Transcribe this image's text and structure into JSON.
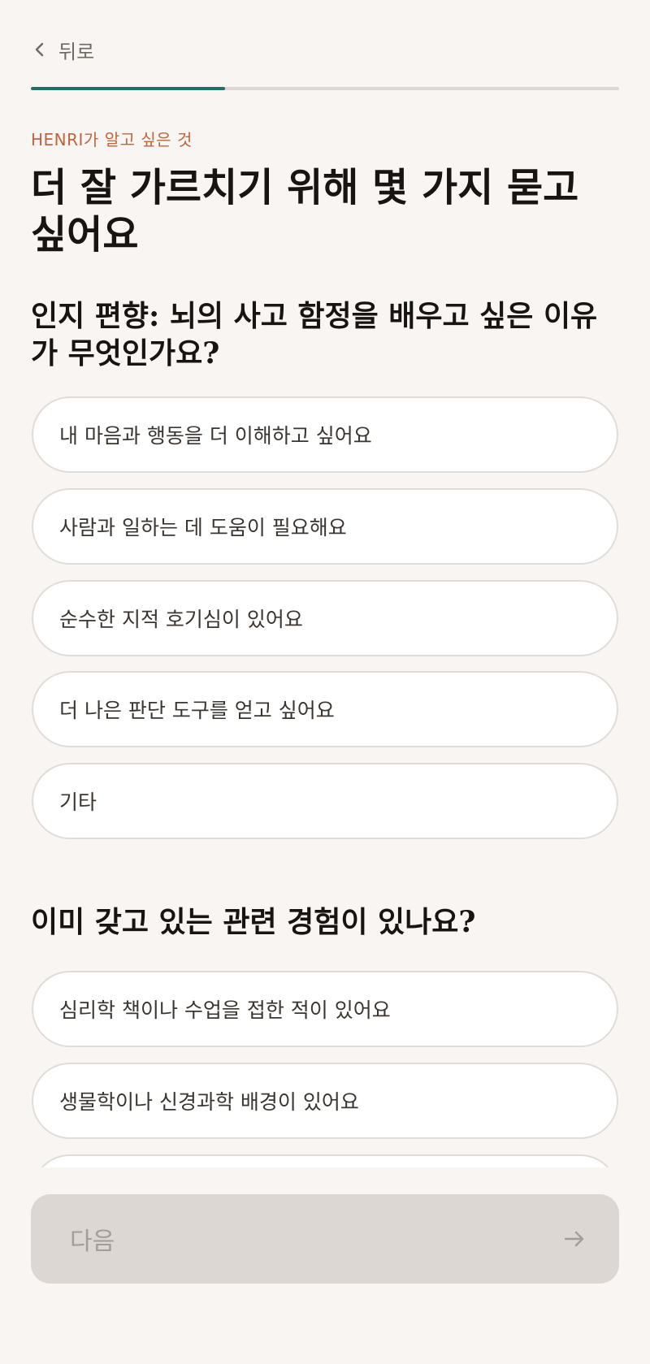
{
  "header": {
    "back_label": "뒤로",
    "back_icon": "chevron-left-icon"
  },
  "progress": {
    "fraction": 0.33,
    "fill_color": "#1f6f66",
    "track_color": "#dcd7d2"
  },
  "intro": {
    "eyebrow": "HENRI가 알고 싶은 것",
    "title": "더 잘 가르치기 위해 몇 가지 묻고 싶어요"
  },
  "questions": [
    {
      "title": "인지 편향: 뇌의 사고 함정을 배우고 싶은 이유가 무엇인가요?",
      "options": [
        "내 마음과 행동을 더 이해하고 싶어요",
        "사람과 일하는 데 도움이 필요해요",
        "순수한 지적 호기심이 있어요",
        "더 나은 판단 도구를 얻고 싶어요",
        "기타"
      ]
    },
    {
      "title": "이미 갖고 있는 관련 경험이 있나요?",
      "options": [
        "심리학 책이나 수업을 접한 적이 있어요",
        "생물학이나 신경과학 배경이 있어요",
        ""
      ]
    }
  ],
  "footer": {
    "next_label": "다음",
    "next_icon": "arrow-right-icon"
  },
  "colors": {
    "background": "#f8f5f2",
    "accent_teal": "#1f6f66",
    "eyebrow_orange": "#c0653c",
    "disabled_button": "#dcd7d2"
  }
}
